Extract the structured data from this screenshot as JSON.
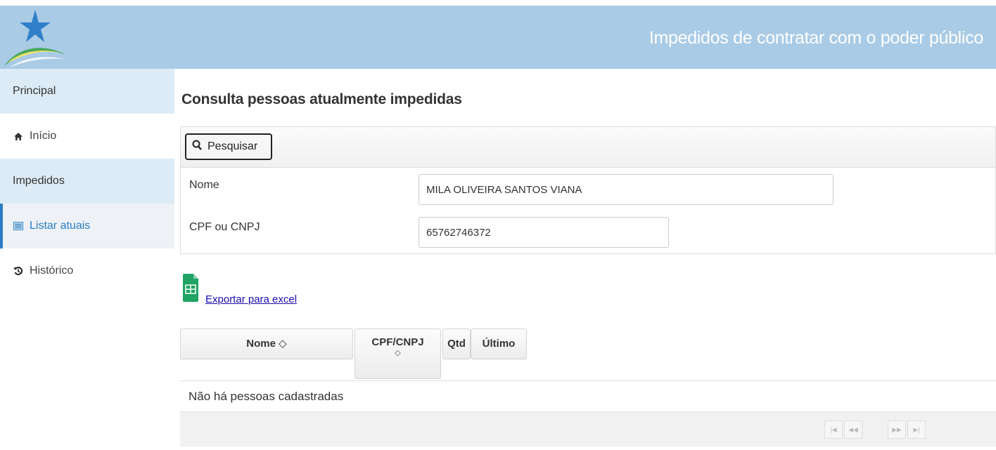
{
  "header": {
    "title": "Impedidos de contratar com o poder público",
    "logo_icon": "star-swoosh-logo"
  },
  "sidebar": {
    "groups": [
      {
        "label": "Principal"
      },
      {
        "label": "Impedidos"
      }
    ],
    "items": [
      {
        "label": "Início",
        "icon": "home-icon"
      },
      {
        "label": "Listar atuais",
        "icon": "list-icon",
        "active": true
      },
      {
        "label": "Histórico",
        "icon": "history-icon"
      }
    ]
  },
  "main": {
    "title": "Consulta pessoas atualmente impedidas",
    "search_button": "Pesquisar",
    "form": {
      "nome_label": "Nome",
      "nome_value": "MILA OLIVEIRA SANTOS VIANA",
      "cpf_label": "CPF ou CNPJ",
      "cpf_value": "65762746372"
    },
    "export_label": "Exportar para excel",
    "table": {
      "columns": [
        {
          "label": "Nome ◇"
        },
        {
          "label": "CPF/CNPJ",
          "sort": "◇"
        },
        {
          "label": "Qtd"
        },
        {
          "label": "Último"
        }
      ],
      "empty_message": "Não há pessoas cadastradas"
    },
    "paginator": [
      "|◀",
      "◀◀",
      "▶▶",
      "▶|"
    ]
  },
  "colors": {
    "header_bg": "#a9cbe6",
    "accent": "#2a7dc2",
    "link": "#1a0dab",
    "excel_green": "#1fa463"
  }
}
